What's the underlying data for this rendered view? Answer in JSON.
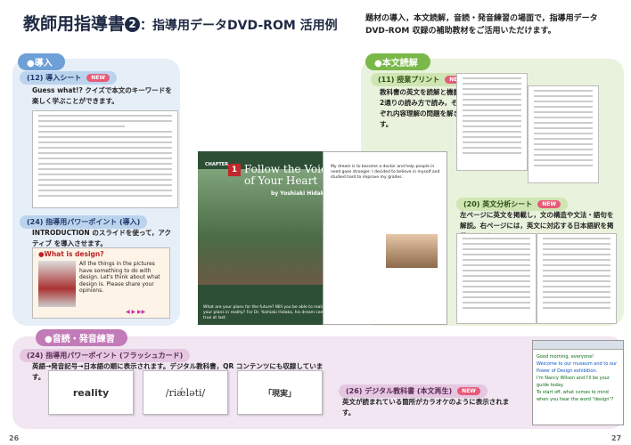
{
  "header": {
    "title_main": "教師用指導書",
    "title_num": "2",
    "title_sub": "：指導用データDVD-ROM 活用例",
    "intro": "題材の導入，本文読解，音読・発音練習の場面で，指導用データ DVD-ROM 収録の補助教材をご活用いただけます。"
  },
  "sections": {
    "intro": {
      "label": "●導入",
      "item1": {
        "label": "(12) 導入シート",
        "badge": "NEW",
        "desc": "Guess what!? クイズで本文のキーワードを楽しく学ぶことができます。"
      },
      "item2": {
        "label": "(24) 指導用パワーポイント (導入)",
        "desc": "INTRODUCTION のスライドを使って，アクティブ を導入させます。",
        "slide_q": "●What is design?",
        "slide_text": "All the things in the pictures have something to do with design. Let's think about what design is. Please share your opinions."
      }
    },
    "reading": {
      "label": "●本文読解",
      "item1": {
        "label": "(11) 授業プリント",
        "badge": "NEW",
        "desc": "教科書の英文を読解と機能の2通りの読み方で読み，それぞれ内容理解の問題を解きます。"
      },
      "item2": {
        "label": "(20) 英文分析シート",
        "badge": "NEW",
        "desc": "左ページに英文を掲載し，文の構造や文法・語句を解説。右ページには，英文に対応する日本語訳を掲載しました。"
      }
    },
    "pron": {
      "label": "●音読・発音練習",
      "item1": {
        "label": "(24) 指導用パワーポイント (フラッシュカード)",
        "desc": "英語→発音記号→日本語の順に表示されます。デジタル教科書，QR コンテンツにも収録しています。",
        "cards": [
          "reality",
          "/riǽləti/",
          "「現実」"
        ]
      },
      "item2": {
        "label": "(26) デジタル教科書 (本文再生)",
        "badge": "NEW",
        "desc": "英文が読まれている箇所がカラオケのように表示されます。"
      }
    }
  },
  "book": {
    "chapter": "CHAPTER",
    "num": "1",
    "title": "Follow the Voice of Your Heart",
    "author": "by Yoshiaki Hidaka",
    "caption": "What are your plans for the future? Will you be able to realize your plans in reality? For Dr. Yoshiaki Hidaka, his dream came true at last.",
    "text": "My dream is to become a doctor and help people in need goes stronger. I decided to believe in myself and studied hard to improve my grades."
  },
  "digital": {
    "lines": [
      "Good morning, everyone!",
      "Welcome to our museum and to our Power of Design exhibition.",
      "I'm Nancy Wilson and I'll be your guide today.",
      "To start off, what comes to mind when you hear the word \"design\"?"
    ]
  },
  "pages": {
    "left": "26",
    "right": "27"
  }
}
